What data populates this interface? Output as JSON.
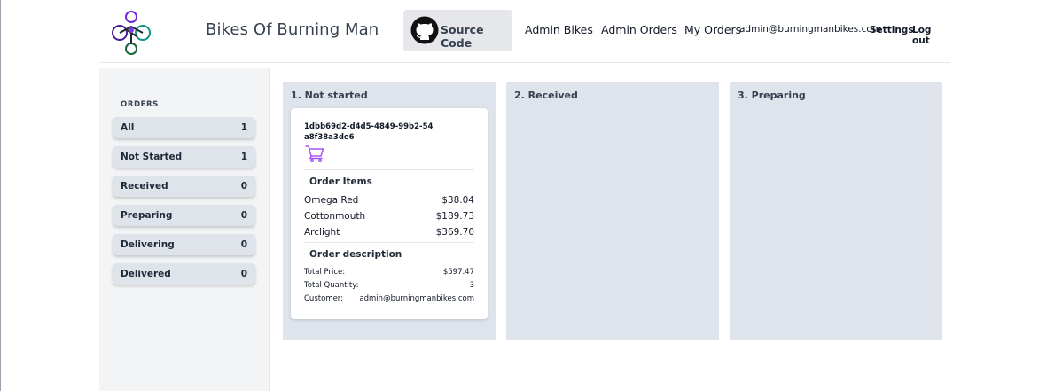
{
  "header": {
    "brand": "Bikes Of Burning Man",
    "source_code_label": "Source Code",
    "nav": {
      "admin_bikes": "Admin Bikes",
      "admin_orders": "Admin Orders",
      "my_orders": "My Orders",
      "email": "admin@burningmanbikes.com",
      "settings": "Settings",
      "logout": "Log out"
    }
  },
  "sidebar": {
    "title": "ORDERS",
    "items": [
      {
        "label": "All",
        "count": "1"
      },
      {
        "label": "Not Started",
        "count": "1"
      },
      {
        "label": "Received",
        "count": "0"
      },
      {
        "label": "Preparing",
        "count": "0"
      },
      {
        "label": "Delivering",
        "count": "0"
      },
      {
        "label": "Delivered",
        "count": "0"
      }
    ]
  },
  "columns": [
    {
      "title": "1. Not started"
    },
    {
      "title": "2. Received"
    },
    {
      "title": "3. Preparing"
    }
  ],
  "order": {
    "id": "1dbb69d2-d4d5-4849-99b2-54a8f38a3de6",
    "icon": "cart-icon",
    "items_heading": "Order Items",
    "items": [
      {
        "name": "Omega Red",
        "price": "$38.04"
      },
      {
        "name": "Cottonmouth",
        "price": "$189.73"
      },
      {
        "name": "Arclight",
        "price": "$369.70"
      }
    ],
    "description_heading": "Order description",
    "description": [
      {
        "key": "Total Price:",
        "value": "$597.47"
      },
      {
        "key": "Total Quantity:",
        "value": "3"
      },
      {
        "key": "Customer:",
        "value": "admin@burningmanbikes.com"
      }
    ]
  },
  "colors": {
    "column_bg": "#dee3ec",
    "sidebar_bg": "#f3f4f6",
    "accent": "#a855f7"
  }
}
